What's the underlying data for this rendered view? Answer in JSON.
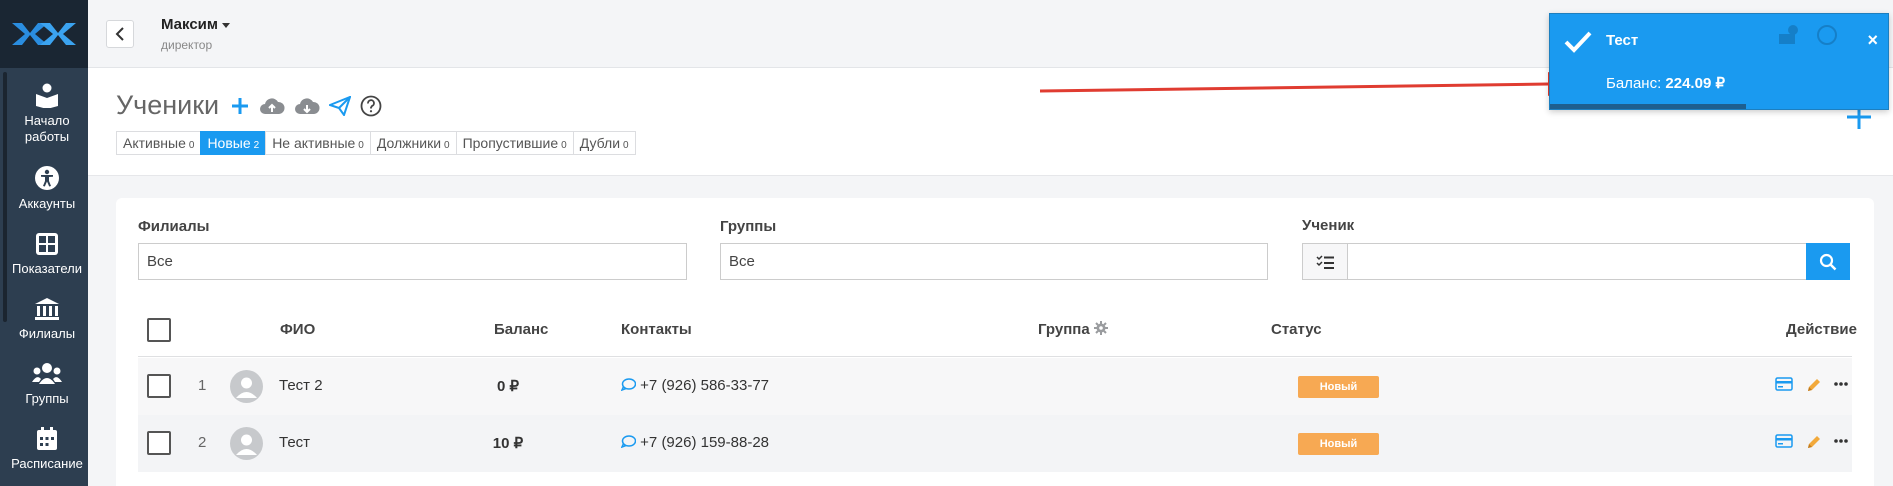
{
  "sidebar": {
    "items": [
      {
        "label": "Начало работы",
        "icon": "book-reader-icon"
      },
      {
        "label": "Аккаунты",
        "icon": "accessibility-icon"
      },
      {
        "label": "Показатели",
        "icon": "grid-icon"
      },
      {
        "label": "Филиалы",
        "icon": "bank-icon"
      },
      {
        "label": "Группы",
        "icon": "users-icon"
      },
      {
        "label": "Расписание",
        "icon": "calendar-icon"
      }
    ]
  },
  "header": {
    "user_name": "Максим",
    "user_role": "директор"
  },
  "page": {
    "title": "Ученики",
    "tabs": [
      {
        "label": "Активные",
        "count": "0",
        "active": false
      },
      {
        "label": "Новые",
        "count": "2",
        "active": true
      },
      {
        "label": "Не активные",
        "count": "0",
        "active": false
      },
      {
        "label": "Должники",
        "count": "0",
        "active": false
      },
      {
        "label": "Пропустившие",
        "count": "0",
        "active": false
      },
      {
        "label": "Дубли",
        "count": "0",
        "active": false
      }
    ]
  },
  "filters": {
    "branches_label": "Филиалы",
    "branches_value": "Все",
    "groups_label": "Группы",
    "groups_value": "Все",
    "student_label": "Ученик",
    "student_value": ""
  },
  "table": {
    "headers": {
      "name": "ФИО",
      "balance": "Баланс",
      "contacts": "Контакты",
      "group": "Группа",
      "status": "Статус",
      "action": "Действие"
    },
    "rows": [
      {
        "num": "1",
        "name": "Тест 2",
        "balance": "0 ₽",
        "phone": "+7 (926) 586-33-77",
        "group": "",
        "status": "Новый"
      },
      {
        "num": "2",
        "name": "Тест",
        "balance": "10 ₽",
        "phone": "+7 (926) 159-88-28",
        "group": "",
        "status": "Новый"
      }
    ]
  },
  "toast": {
    "title": "Тест",
    "message_prefix": "Баланс:",
    "message_value": "224.09 ₽",
    "progress": 0.58,
    "close": "×"
  },
  "colors": {
    "accent": "#1a9af0",
    "sidebar": "#2d3e50",
    "status_new": "#f7a953",
    "arrow": "#e03c31"
  }
}
